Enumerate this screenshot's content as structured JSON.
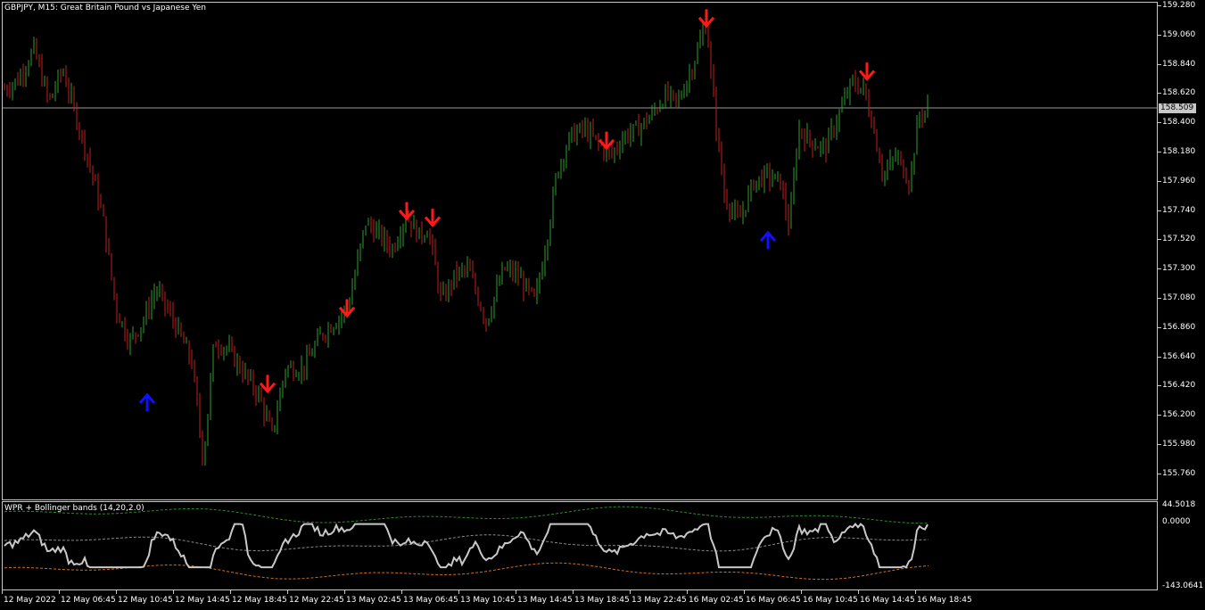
{
  "main_chart": {
    "title": "GBPJPY, M15:  Great Britain Pound vs Japanese Yen",
    "current_price": "158.509",
    "price_axis": [
      "159.280",
      "159.060",
      "158.840",
      "158.620",
      "158.400",
      "158.180",
      "157.960",
      "157.740",
      "157.520",
      "157.300",
      "157.080",
      "156.860",
      "156.640",
      "156.420",
      "156.200",
      "155.980",
      "155.760"
    ]
  },
  "indicator": {
    "title": "WPR + Bollinger bands (14,20,2.0)",
    "axis": [
      "44.5018",
      "0.0000",
      "-143.0641"
    ]
  },
  "time_axis": [
    "12 May 2022",
    "12 May 06:45",
    "12 May 10:45",
    "12 May 14:45",
    "12 May 18:45",
    "12 May 22:45",
    "13 May 02:45",
    "13 May 06:45",
    "13 May 10:45",
    "13 May 14:45",
    "13 May 18:45",
    "13 May 22:45",
    "16 May 02:45",
    "16 May 06:45",
    "16 May 10:45",
    "16 May 14:45",
    "16 May 18:45"
  ],
  "colors": {
    "bull": "#2e9e2e",
    "bear": "#c0201c",
    "sell_arrow": "#ff1a1a",
    "buy_arrow": "#1010ff",
    "wpr_line": "#c8c8c8",
    "band": "#d07020",
    "mid_band": "#8a8a8a",
    "upper_band": "#2e8a2e",
    "wpr_overbought": "#33cc33",
    "wpr_oversold": "#ff9900",
    "grid": "#444444"
  },
  "chart_data": {
    "type": "candlestick",
    "symbol": "GBPJPY",
    "timeframe": "M15",
    "ylim": [
      155.65,
      159.32
    ],
    "signals": {
      "sell": [
        {
          "time": "12 May 18:00",
          "price": 156.45
        },
        {
          "time": "13 May 00:45",
          "price": 157.02
        },
        {
          "time": "13 May 05:30",
          "price": 157.75
        },
        {
          "time": "13 May 06:15",
          "price": 157.7
        },
        {
          "time": "13 May 19:45",
          "price": 158.28
        },
        {
          "time": "16 May 02:45",
          "price": 159.2
        },
        {
          "time": "16 May 12:00",
          "price": 158.8
        }
      ],
      "buy": [
        {
          "time": "12 May 10:15",
          "price": 156.33
        },
        {
          "time": "16 May 06:45",
          "price": 157.55
        }
      ]
    }
  }
}
